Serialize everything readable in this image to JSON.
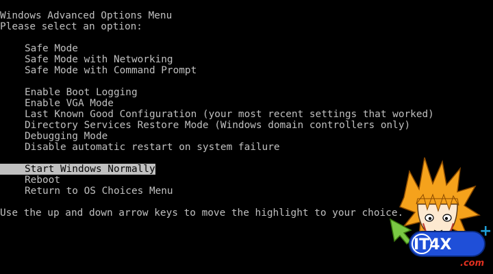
{
  "menu": {
    "title": "Windows Advanced Options Menu",
    "prompt": "Please select an option:",
    "safe_group": [
      "Safe Mode",
      "Safe Mode with Networking",
      "Safe Mode with Command Prompt"
    ],
    "boot_group": [
      "Enable Boot Logging",
      "Enable VGA Mode",
      "Last Known Good Configuration (your most recent settings that worked)",
      "Directory Services Restore Mode (Windows domain controllers only)",
      "Debugging Mode",
      "Disable automatic restart on system failure"
    ],
    "selected": "Start Windows Normally",
    "other_group": [
      "Reboot",
      "Return to OS Choices Menu"
    ],
    "instructions": "Use the up and down arrow keys to move the highlight to your choice."
  },
  "watermark": {
    "brand": "IT4X",
    "plus": "+",
    "domain": ".com"
  },
  "colors": {
    "background": "#000000",
    "text": "#c0c0c0",
    "highlight_bg": "#c0c0c0",
    "highlight_text": "#000000",
    "logo_blue": "#1f4fd8",
    "logo_orange": "#f5a21c",
    "logo_green": "#7ac943"
  }
}
